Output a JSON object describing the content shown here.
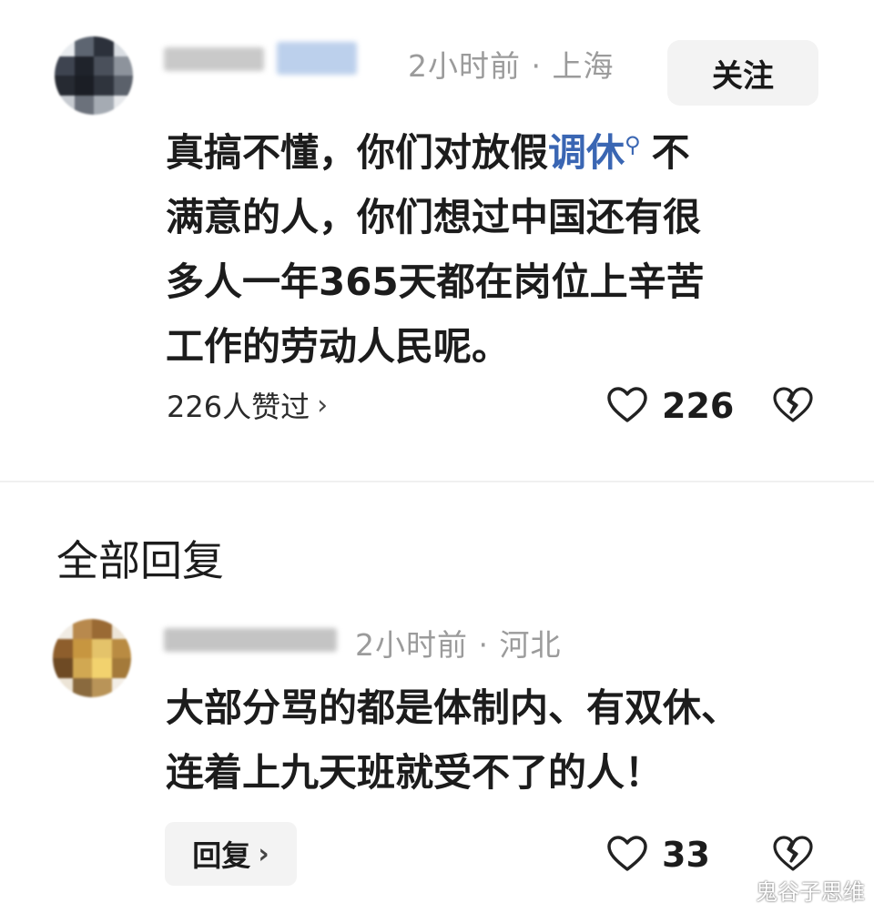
{
  "colors": {
    "link": "#3a66b3",
    "meta": "#9b9b9b",
    "button_bg": "#f3f3f3"
  },
  "top_comment": {
    "time": "2小时前",
    "location": "上海",
    "follow_label": "关注",
    "lines": [
      {
        "before": "真搞不懂，你们对放假",
        "link": "调休",
        "after": "不"
      },
      "满意的人，你们想过中国还有很",
      "多人一年365天都在岗位上辛苦",
      "工作的劳动人民呢。"
    ],
    "search_icon": "search-icon",
    "liked_by_label": "226人赞过",
    "like_count": "226",
    "like_icon": "heart-outline-icon",
    "dislike_icon": "broken-heart-icon"
  },
  "replies_section": {
    "title": "全部回复"
  },
  "reply": {
    "time": "2小时前",
    "location": "河北",
    "lines": [
      "大部分骂的都是体制内、有双休、",
      "连着上九天班就受不了的人！"
    ],
    "reply_label": "回复",
    "like_count": "33"
  },
  "watermark": "鬼谷子思维"
}
